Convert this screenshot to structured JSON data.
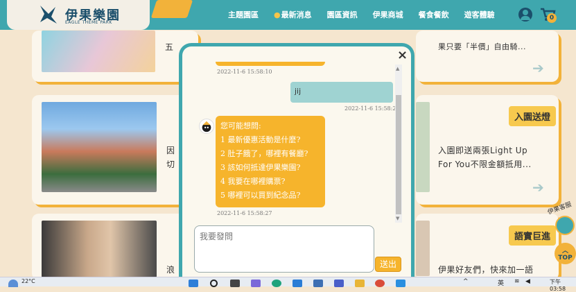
{
  "header": {
    "logo_title": "伊果樂園",
    "logo_sub": "EAGLE THEME PARK",
    "nav": [
      "主題園區",
      "最新消息",
      "園區資訊",
      "伊果商城",
      "餐食餐飲",
      "遊客體驗"
    ],
    "cart_count": "0"
  },
  "cards": {
    "card1_text": "五",
    "card1_right_text": "果只要「半價」自由騎...",
    "card2_left_text1": "因",
    "card2_left_text2": "切",
    "card2_tag": "入園送燈",
    "card2_right_line1": "入園即送兩張Light Up",
    "card2_right_line2": "For You不限金額抵用...",
    "card3_tag": "語實巨進",
    "card3_left_text": "浪",
    "card3_right_text": "伊果好友們，快來加一語"
  },
  "chat": {
    "stamp1": "2022-11-6 15:58:10",
    "user_message": "jij",
    "stamp2": "2022-11-6 15:58:27",
    "bot_lines": [
      "您可能想問:",
      "1 最新優惠活動是什麼?",
      "2 肚子餓了，哪裡有餐廳?",
      "3 該如何抵達伊果樂園?",
      "4 我要在哪裡購票?",
      "5 哪裡可以買到紀念品?"
    ],
    "stamp3": "2022-11-6 15:58:27",
    "input_placeholder": "我要發問",
    "send_label": "送出",
    "close_label": "×"
  },
  "side": {
    "cs_label": "伊果客服",
    "top_label": "TOP"
  },
  "taskbar": {
    "temperature": "22°C",
    "ime": "英",
    "time": "下午 03:58"
  },
  "colors": {
    "teal": "#3fa7ae",
    "orange": "#f6b42c",
    "user_bubble": "#9fd3d2",
    "page_bg": "#f5e6cf"
  }
}
